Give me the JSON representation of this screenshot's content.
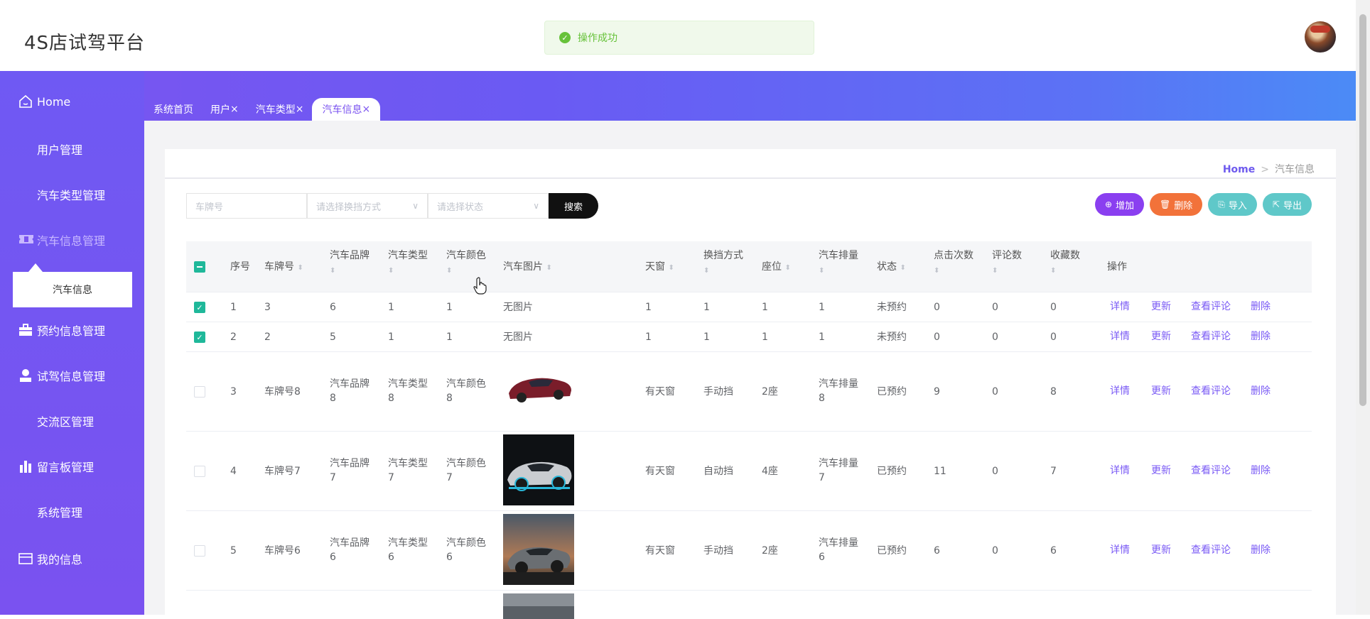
{
  "header": {
    "app_title": "4S店试驾平台",
    "toast": "操作成功"
  },
  "sidebar": {
    "items": [
      {
        "label": "Home",
        "icon": "home-icon"
      },
      {
        "label": "用户管理",
        "icon": "grid-icon"
      },
      {
        "label": "汽车类型管理",
        "icon": "grid-icon"
      },
      {
        "label": "汽车信息管理",
        "icon": "ticket-icon"
      },
      {
        "label": "预约信息管理",
        "icon": "briefcase-icon"
      },
      {
        "label": "试驾信息管理",
        "icon": "user-icon"
      },
      {
        "label": "交流区管理",
        "icon": "grid-icon"
      },
      {
        "label": "留言板管理",
        "icon": "bar-chart-icon"
      },
      {
        "label": "系统管理",
        "icon": "grid-icon"
      },
      {
        "label": "我的信息",
        "icon": "card-icon"
      }
    ],
    "sub_item": "汽车信息"
  },
  "tabs": [
    "系统首页",
    "用户",
    "汽车类型",
    "汽车信息"
  ],
  "breadcrumb": {
    "home": "Home",
    "sep": ">",
    "current": "汽车信息"
  },
  "filters": {
    "plate_placeholder": "车牌号",
    "gear_placeholder": "请选择换挡方式",
    "status_placeholder": "请选择状态",
    "search_label": "搜索"
  },
  "actions": {
    "add": "增加",
    "delete": "删除",
    "import": "导入",
    "export": "导出"
  },
  "colors": {
    "add": "#8a3ff0",
    "delete": "#f2723a",
    "import": "#5fc8c9",
    "export": "#5fc8c9",
    "accent": "#7a52f0"
  },
  "table": {
    "headers": {
      "index": "序号",
      "plate": "车牌号",
      "brand": "汽车品牌",
      "type": "汽车类型",
      "color": "汽车颜色",
      "image": "汽车图片",
      "sunroof": "天窗",
      "gear": "换挡方式",
      "seats": "座位",
      "displacement": "汽车排量",
      "status": "状态",
      "clicks": "点击次数",
      "comments": "评论数",
      "favorites": "收藏数",
      "ops": "操作"
    },
    "ops": {
      "detail": "详情",
      "update": "更新",
      "view_comments": "查看评论",
      "delete": "删除"
    },
    "rows": [
      {
        "checked": true,
        "index": "1",
        "plate": "3",
        "brand": "6",
        "type": "1",
        "color": "1",
        "image": "无图片",
        "sunroof": "1",
        "gear": "1",
        "seats": "1",
        "displacement": "1",
        "status": "未预约",
        "clicks": "0",
        "comments": "0",
        "favorites": "0"
      },
      {
        "checked": true,
        "index": "2",
        "plate": "2",
        "brand": "5",
        "type": "1",
        "color": "1",
        "image": "无图片",
        "sunroof": "1",
        "gear": "1",
        "seats": "1",
        "displacement": "1",
        "status": "未预约",
        "clicks": "0",
        "comments": "0",
        "favorites": "0"
      },
      {
        "checked": false,
        "index": "3",
        "plate": "车牌号8",
        "brand1": "汽车品牌",
        "brand2": "8",
        "type1": "汽车类型",
        "type2": "8",
        "color1": "汽车颜色",
        "color2": "8",
        "sunroof": "有天窗",
        "gear": "手动挡",
        "seats": "2座",
        "disp1": "汽车排量",
        "disp2": "8",
        "status": "已预约",
        "clicks": "9",
        "comments": "0",
        "favorites": "8"
      },
      {
        "checked": false,
        "index": "4",
        "plate": "车牌号7",
        "brand1": "汽车品牌",
        "brand2": "7",
        "type1": "汽车类型",
        "type2": "7",
        "color1": "汽车颜色",
        "color2": "7",
        "sunroof": "有天窗",
        "gear": "自动挡",
        "seats": "4座",
        "disp1": "汽车排量",
        "disp2": "7",
        "status": "已预约",
        "clicks": "11",
        "comments": "0",
        "favorites": "7"
      },
      {
        "checked": false,
        "index": "5",
        "plate": "车牌号6",
        "brand1": "汽车品牌",
        "brand2": "6",
        "type1": "汽车类型",
        "type2": "6",
        "color1": "汽车颜色",
        "color2": "6",
        "sunroof": "有天窗",
        "gear": "手动挡",
        "seats": "2座",
        "disp1": "汽车排量",
        "disp2": "6",
        "status": "已预约",
        "clicks": "6",
        "comments": "0",
        "favorites": "6"
      }
    ]
  }
}
